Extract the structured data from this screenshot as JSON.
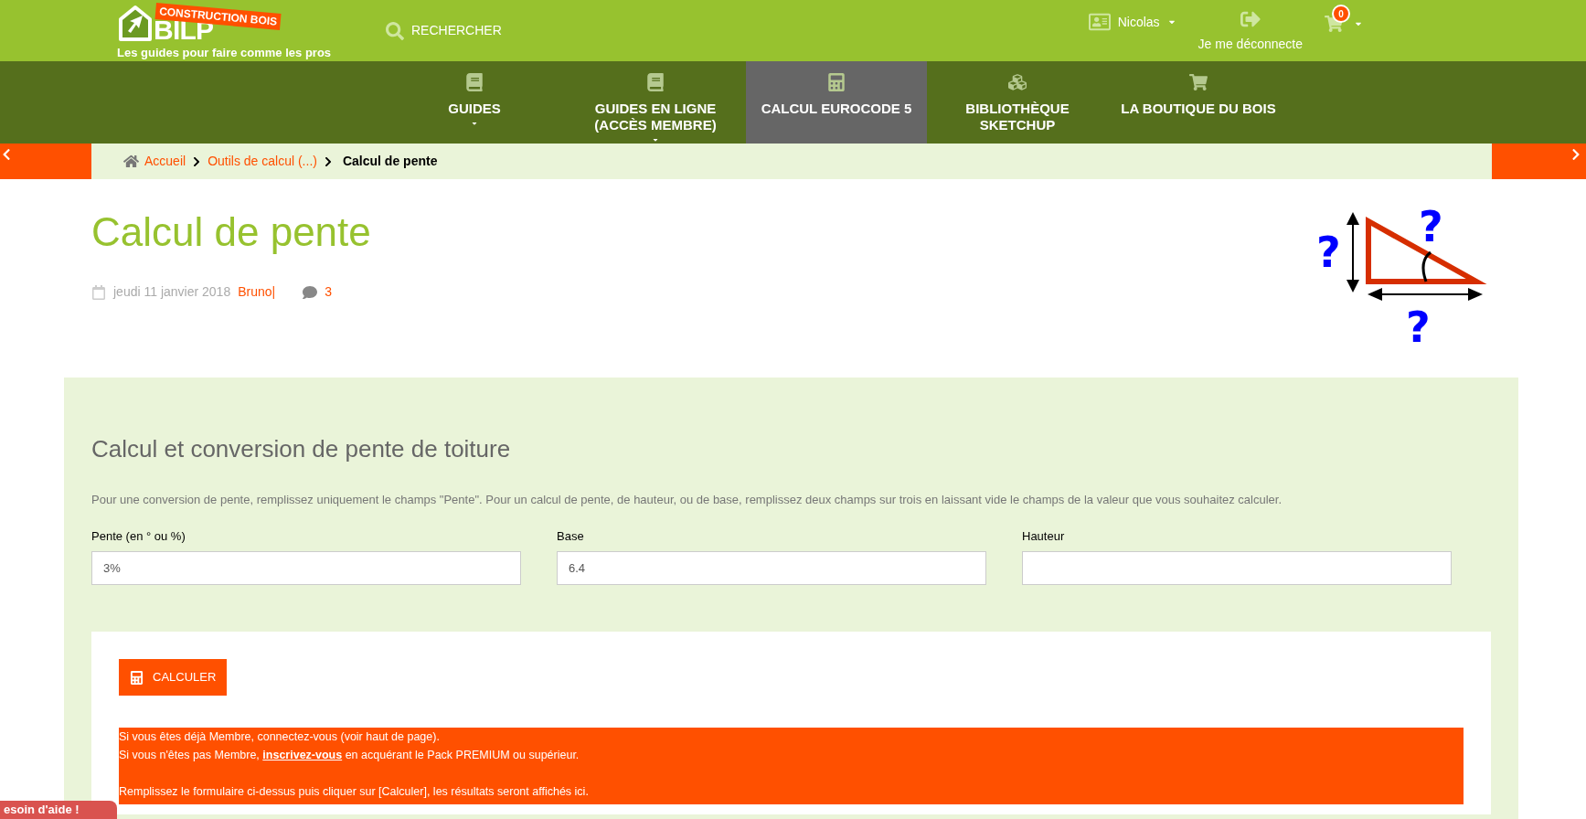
{
  "header": {
    "logo": {
      "badge": "CONSTRUCTION BOIS",
      "name": "BILP",
      "tagline": "Les guides pour faire comme les pros"
    },
    "search": "RECHERCHER",
    "user": "Nicolas",
    "logout": "Je me déconnecte",
    "cart_count": "0"
  },
  "nav": [
    {
      "label": "GUIDES",
      "kind": "book",
      "selected": false,
      "dropdown": true
    },
    {
      "label": "GUIDES EN LIGNE (ACCÈS MEMBRE)",
      "kind": "book",
      "selected": false,
      "dropdown": true
    },
    {
      "label": "CALCUL EUROCODE 5",
      "kind": "calculator",
      "selected": true,
      "dropdown": false
    },
    {
      "label": "BIBLIOTHÈQUE SKETCHUP",
      "kind": "cubes",
      "selected": false,
      "dropdown": false
    },
    {
      "label": "LA BOUTIQUE DU BOIS",
      "kind": "cart",
      "selected": false,
      "dropdown": false
    }
  ],
  "breadcrumb": [
    {
      "label": "Accueil",
      "current": false
    },
    {
      "label": "Outils de calcul (...)",
      "current": false
    },
    {
      "label": "Calcul de pente",
      "current": true
    }
  ],
  "page": {
    "title": "Calcul de pente",
    "date": "jeudi 11 janvier 2018",
    "author": "Bruno",
    "separator": "|",
    "comments": "3",
    "illustration_marks": [
      "?",
      "?",
      "?"
    ]
  },
  "form": {
    "heading": "Calcul et conversion de pente de toiture",
    "intro": "Pour une conversion de pente, remplissez uniquement le champs \"Pente\". Pour un calcul de pente, de hauteur, ou de base, remplissez deux champs sur trois en laissant vide le champs de la valeur que vous souhaitez calculer.",
    "fields": [
      {
        "label": "Pente (en ° ou %)",
        "value": "3%"
      },
      {
        "label": "Base",
        "value": "6.4"
      },
      {
        "label": "Hauteur"
      }
    ],
    "button": "CALCULER",
    "message": {
      "line_1": "Si vous êtes déjà Membre, connectez-vous (voir haut de page).",
      "line_2": {
        "before": "Si vous n'êtes pas Membre, ",
        "link": "inscrivez-vous",
        "after": " en acquérant le Pack PREMIUM ou supérieur."
      },
      "line_3": "Remplissez le formulaire ci-dessus puis cliquer sur [Calculer], les résultats seront affichés ici."
    }
  },
  "help_tab": "esoin d'aide !"
}
